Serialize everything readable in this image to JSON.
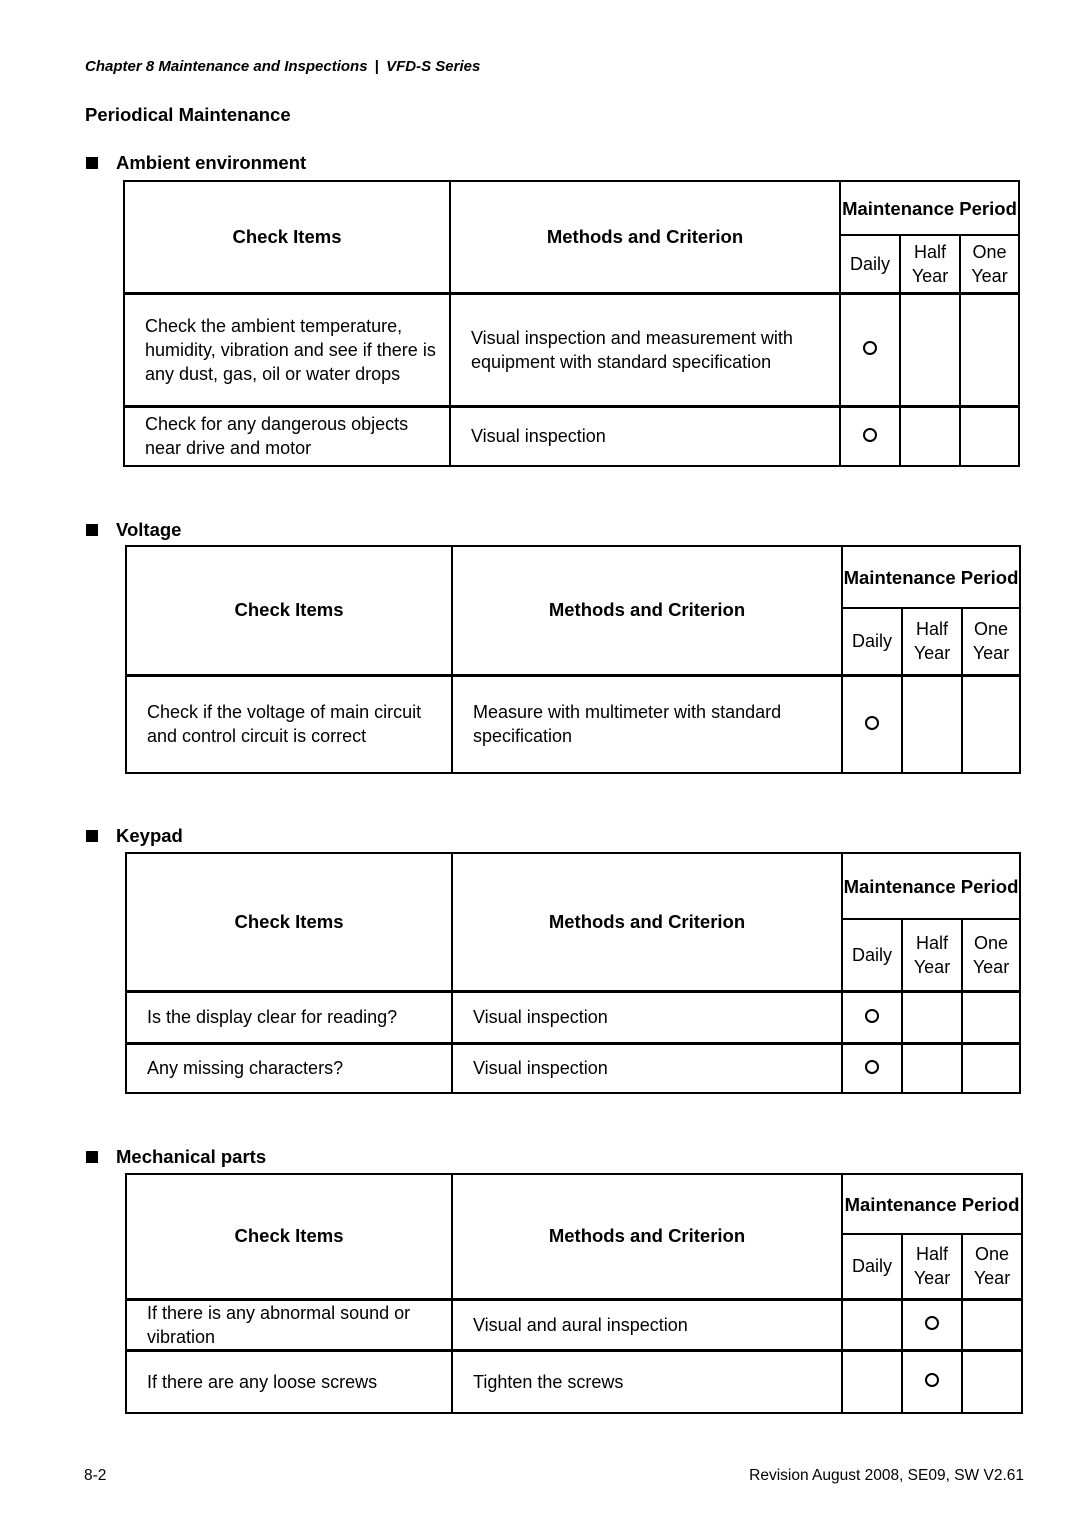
{
  "header": {
    "chapter": "Chapter 8 Maintenance and Inspections",
    "separator": "|",
    "series": "VFD-S Series"
  },
  "title": "Periodical Maintenance",
  "col_headers": {
    "check": "Check Items",
    "method": "Methods and Criterion",
    "period": "Maintenance Period",
    "daily": "Daily",
    "half": "Half Year",
    "one": "One Year"
  },
  "mark_symbol": "O",
  "sections": [
    {
      "title": "Ambient environment",
      "rows": [
        {
          "check": "Check the ambient temperature, humidity, vibration and see if there is any dust, gas, oil or water drops",
          "method": "Visual inspection and measurement with equipment with standard specification",
          "daily": true,
          "half": false,
          "one": false
        },
        {
          "check": "Check for any dangerous objects near drive and motor",
          "method": "Visual inspection",
          "daily": true,
          "half": false,
          "one": false
        }
      ]
    },
    {
      "title": "Voltage",
      "rows": [
        {
          "check": "Check if the voltage of main circuit and control circuit is correct",
          "method": "Measure with multimeter with standard specification",
          "daily": true,
          "half": false,
          "one": false
        }
      ]
    },
    {
      "title": "Keypad",
      "rows": [
        {
          "check": "Is the display clear for reading?",
          "method": "Visual inspection",
          "daily": true,
          "half": false,
          "one": false
        },
        {
          "check": "Any missing characters?",
          "method": "Visual inspection",
          "daily": true,
          "half": false,
          "one": false
        }
      ]
    },
    {
      "title": "Mechanical parts",
      "rows": [
        {
          "check": "If there is any abnormal sound or vibration",
          "method": "Visual and aural inspection",
          "daily": false,
          "half": true,
          "one": false
        },
        {
          "check": "If there are any loose screws",
          "method": "Tighten the screws",
          "daily": false,
          "half": true,
          "one": false
        }
      ]
    }
  ],
  "footer": {
    "page": "8-2",
    "revision": "Revision August 2008, SE09, SW V2.61"
  }
}
